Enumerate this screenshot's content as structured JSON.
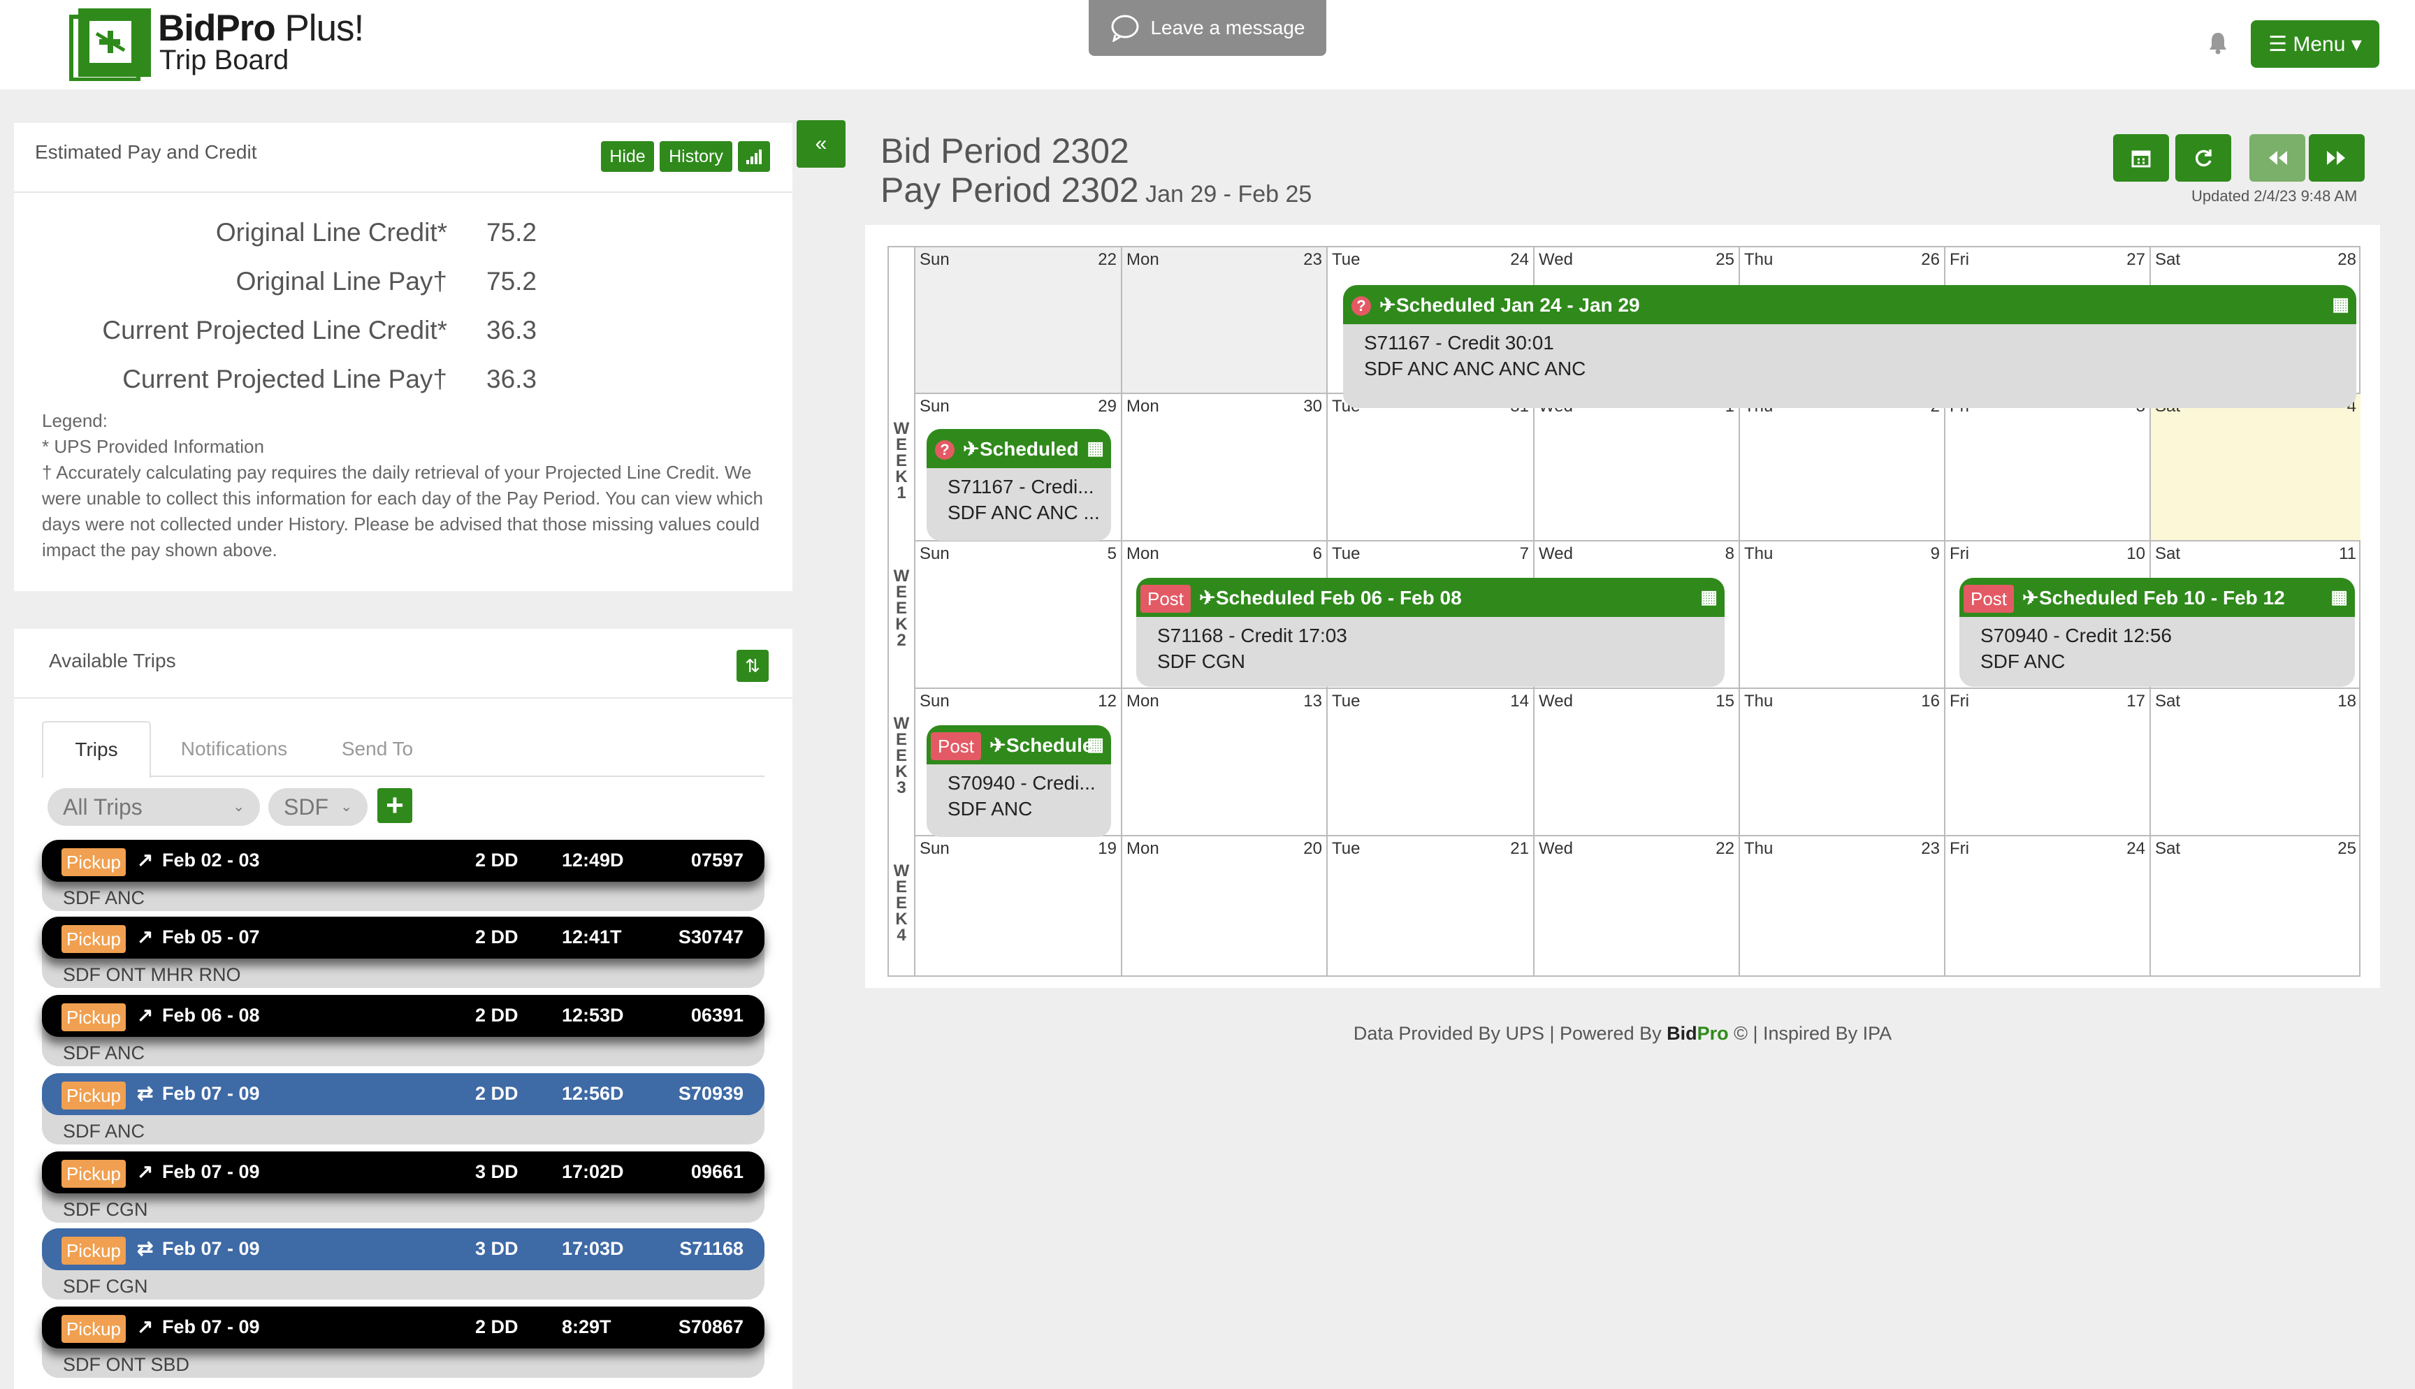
{
  "brand": {
    "name_bold": "BidPro",
    "name_plus": " Plus!",
    "subtitle": "Trip Board",
    "footer_brand_a": "Bid",
    "footer_brand_b": "Pro"
  },
  "header": {
    "leave_message": "Leave a message",
    "menu": "☰ Menu ▾"
  },
  "pay": {
    "title": "Estimated Pay and Credit",
    "hide": "Hide",
    "history": "History",
    "rows": [
      {
        "label": "Original Line Credit*",
        "value": "75.2"
      },
      {
        "label": "Original Line Pay†",
        "value": "75.2"
      },
      {
        "label": "Current Projected Line Credit*",
        "value": "36.3"
      },
      {
        "label": "Current Projected Line Pay†",
        "value": "36.3"
      }
    ],
    "legend": [
      "Legend:",
      "* UPS Provided Information",
      "† Accurately calculating pay requires the daily retrieval of your Projected Line Credit. We were unable to collect this information for each day of the Pay Period. You can view which days were not collected under History. Please be advised that those missing values could impact the pay shown above."
    ]
  },
  "trips_panel": {
    "title": "Available Trips",
    "tabs": [
      "Trips",
      "Notifications",
      "Send To"
    ],
    "filter_all": "All Trips",
    "filter_base": "SDF",
    "trips": [
      {
        "tag": "Pickup",
        "date": "Feb 02 - 03",
        "dd": "2 DD",
        "time": "12:49D",
        "id": "07597",
        "route": "SDF ANC",
        "color": "black",
        "icon": "↗"
      },
      {
        "tag": "Pickup",
        "date": "Feb 05 - 07",
        "dd": "2 DD",
        "time": "12:41T",
        "id": "S30747",
        "route": "SDF ONT MHR RNO",
        "color": "black",
        "icon": "↗"
      },
      {
        "tag": "Pickup",
        "date": "Feb 06 - 08",
        "dd": "2 DD",
        "time": "12:53D",
        "id": "06391",
        "route": "SDF ANC",
        "color": "black",
        "icon": "↗"
      },
      {
        "tag": "Pickup",
        "date": "Feb 07 - 09",
        "dd": "2 DD",
        "time": "12:56D",
        "id": "S70939",
        "route": "SDF ANC",
        "color": "blue",
        "icon": "⇄"
      },
      {
        "tag": "Pickup",
        "date": "Feb 07 - 09",
        "dd": "3 DD",
        "time": "17:02D",
        "id": "09661",
        "route": "SDF CGN",
        "color": "black",
        "icon": "↗"
      },
      {
        "tag": "Pickup",
        "date": "Feb 07 - 09",
        "dd": "3 DD",
        "time": "17:03D",
        "id": "S71168",
        "route": "SDF CGN",
        "color": "blue",
        "icon": "⇄"
      },
      {
        "tag": "Pickup",
        "date": "Feb 07 - 09",
        "dd": "2 DD",
        "time": "8:29T",
        "id": "S70867",
        "route": "SDF ONT SBD",
        "color": "black",
        "icon": "↗"
      }
    ]
  },
  "calendar": {
    "bid_period": "Bid Period 2302",
    "pay_period": "Pay Period 2302",
    "pay_range": " Jan 29 - Feb 25",
    "updated": "Updated 2/4/23 9:48 AM",
    "day_names": [
      "Sun",
      "Mon",
      "Tue",
      "Wed",
      "Thu",
      "Fri",
      "Sat"
    ],
    "weeks": [
      {
        "label": "",
        "days": [
          "22",
          "23",
          "24",
          "25",
          "26",
          "27",
          "28"
        ]
      },
      {
        "label": "WEEK 1",
        "days": [
          "29",
          "30",
          "31",
          "1",
          "2",
          "3",
          "4"
        ]
      },
      {
        "label": "WEEK 2",
        "days": [
          "5",
          "6",
          "7",
          "8",
          "9",
          "10",
          "11"
        ]
      },
      {
        "label": "WEEK 3",
        "days": [
          "12",
          "13",
          "14",
          "15",
          "16",
          "17",
          "18"
        ]
      },
      {
        "label": "WEEK 4",
        "days": [
          "19",
          "20",
          "21",
          "22",
          "23",
          "24",
          "25"
        ]
      }
    ],
    "events": [
      {
        "badge": "?",
        "head": "Scheduled Jan 24 - Jan 29",
        "line1": "S71167 - Credit 30:01",
        "line2": "SDF ANC ANC ANC ANC"
      },
      {
        "badge": "?",
        "head": "Scheduled",
        "line1": "S71167 - Credi...",
        "line2": "SDF ANC ANC ..."
      },
      {
        "badge": "Post",
        "head": "Scheduled Feb 06 - Feb 08",
        "line1": "S71168 - Credit 17:03",
        "line2": "SDF CGN"
      },
      {
        "badge": "Post",
        "head": "Scheduled Feb 10 - Feb 12",
        "line1": "S70940 - Credit 12:56",
        "line2": "SDF ANC"
      },
      {
        "badge": "Post",
        "head": "Schedule",
        "line1": "S70940 - Credi...",
        "line2": "SDF ANC"
      }
    ]
  },
  "footer": {
    "a": "Data Provided By UPS | Powered By ",
    "b": " © | Inspired By IPA"
  }
}
